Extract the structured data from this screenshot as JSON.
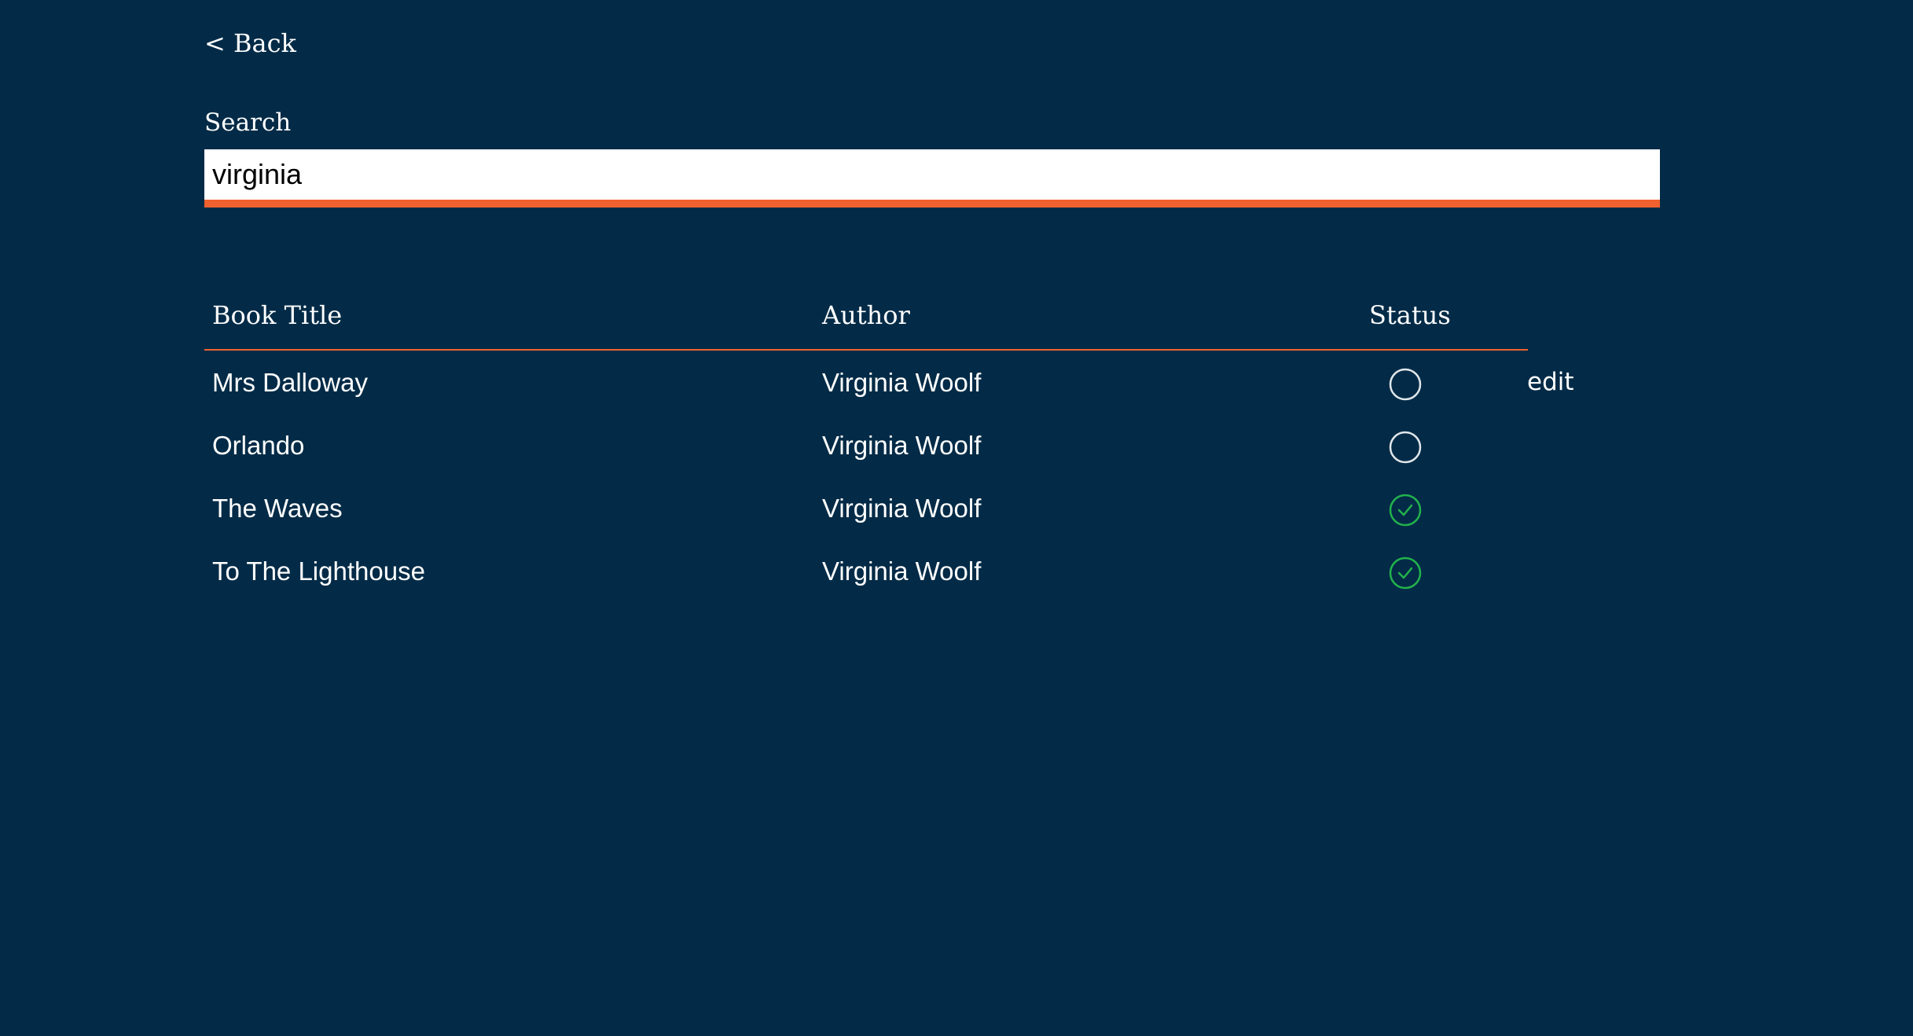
{
  "nav": {
    "back_label": "< Back"
  },
  "search": {
    "label": "Search",
    "value": "virginia",
    "placeholder": ""
  },
  "table": {
    "headers": {
      "title": "Book Title",
      "author": "Author",
      "status": "Status"
    },
    "rows": [
      {
        "title": "Mrs Dalloway",
        "author": "Virginia Woolf",
        "status": "unread",
        "status_icon": "empty-circle-icon",
        "action": "edit"
      },
      {
        "title": "Orlando",
        "author": "Virginia Woolf",
        "status": "unread",
        "status_icon": "empty-circle-icon"
      },
      {
        "title": "The Waves",
        "author": "Virginia Woolf",
        "status": "read",
        "status_icon": "check-circle-icon"
      },
      {
        "title": "To The Lighthouse",
        "author": "Virginia Woolf",
        "status": "read",
        "status_icon": "check-circle-icon"
      }
    ]
  },
  "colors": {
    "background": "#032b47",
    "accent": "#f0612f",
    "read_status": "#22b24c",
    "unread_status": "#e0e6ea"
  }
}
